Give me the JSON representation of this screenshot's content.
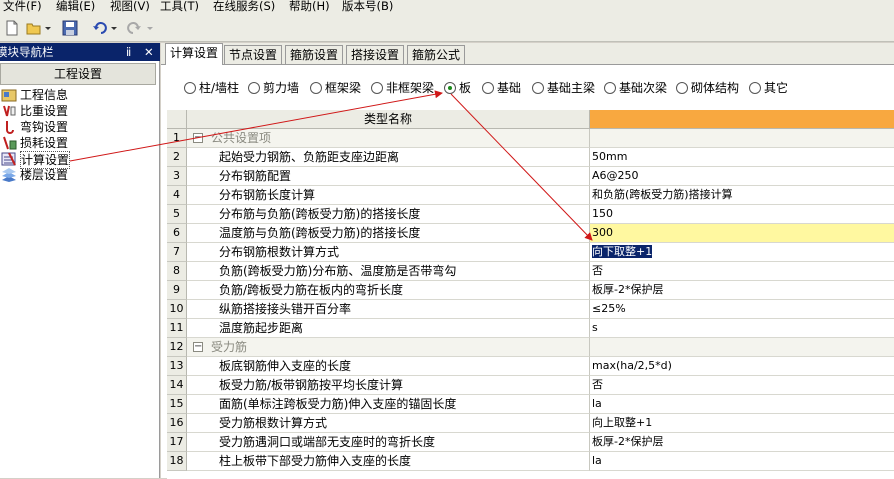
{
  "menu": [
    "文件(F)",
    "编辑(E)",
    "视图(V)",
    "工具(T)",
    "在线服务(S)",
    "帮助(H)",
    "版本号(B)"
  ],
  "left_panel": {
    "title": "模块导航栏",
    "pin": "ⅱ",
    "close": "✕",
    "button": "工程设置",
    "items": [
      {
        "label": "工程信息",
        "icon": "info-icon"
      },
      {
        "label": "比重设置",
        "icon": "weight-icon"
      },
      {
        "label": "弯钩设置",
        "icon": "hook-icon"
      },
      {
        "label": "损耗设置",
        "icon": "loss-icon"
      },
      {
        "label": "计算设置",
        "icon": "calc-icon"
      },
      {
        "label": "楼层设置",
        "icon": "floor-icon"
      }
    ]
  },
  "tabs": [
    "计算设置",
    "节点设置",
    "箍筋设置",
    "搭接设置",
    "箍筋公式"
  ],
  "radios": [
    "柱/墙柱",
    "剪力墙",
    "框架梁",
    "非框架梁",
    "板",
    "基础",
    "基础主梁",
    "基础次梁",
    "砌体结构",
    "其它"
  ],
  "selected_radio": "板",
  "grid": {
    "header": "类型名称",
    "rows": [
      {
        "num": "1",
        "name": "公共设置项",
        "value": "",
        "group": true,
        "toggle": "−"
      },
      {
        "num": "2",
        "name": "起始受力钢筋、负筋距支座边距离",
        "value": "50mm"
      },
      {
        "num": "3",
        "name": "分布钢筋配置",
        "value": "A6@250"
      },
      {
        "num": "4",
        "name": "分布钢筋长度计算",
        "value": "和负筋(跨板受力筋)搭接计算"
      },
      {
        "num": "5",
        "name": "分布筋与负筋(跨板受力筋)的搭接长度",
        "value": "150"
      },
      {
        "num": "6",
        "name": "温度筋与负筋(跨板受力筋)的搭接长度",
        "value": "300",
        "highlight": true
      },
      {
        "num": "7",
        "name": "分布钢筋根数计算方式",
        "value": "向下取整+1",
        "selected": true
      },
      {
        "num": "8",
        "name": "负筋(跨板受力筋)分布筋、温度筋是否带弯勾",
        "value": "否"
      },
      {
        "num": "9",
        "name": "负筋/跨板受力筋在板内的弯折长度",
        "value": "板厚-2*保护层"
      },
      {
        "num": "10",
        "name": "纵筋搭接接头错开百分率",
        "value": "≤25%"
      },
      {
        "num": "11",
        "name": "温度筋起步距离",
        "value": "s"
      },
      {
        "num": "12",
        "name": "受力筋",
        "value": "",
        "group": true,
        "toggle": "−"
      },
      {
        "num": "13",
        "name": "板底钢筋伸入支座的长度",
        "value": "max(ha/2,5*d)"
      },
      {
        "num": "14",
        "name": "板受力筋/板带钢筋按平均长度计算",
        "value": "否"
      },
      {
        "num": "15",
        "name": "面筋(单标注跨板受力筋)伸入支座的锚固长度",
        "value": "la"
      },
      {
        "num": "16",
        "name": "受力筋根数计算方式",
        "value": "向上取整+1"
      },
      {
        "num": "17",
        "name": "受力筋遇洞口或端部无支座时的弯折长度",
        "value": "板厚-2*保护层"
      },
      {
        "num": "18",
        "name": "柱上板带下部受力筋伸入支座的长度",
        "value": "la"
      }
    ]
  },
  "colors": {
    "header_accent": "#f8a840",
    "highlight_row": "#fff8a0",
    "selection": "#0a246a",
    "annotation_arrow": "#d01818"
  }
}
